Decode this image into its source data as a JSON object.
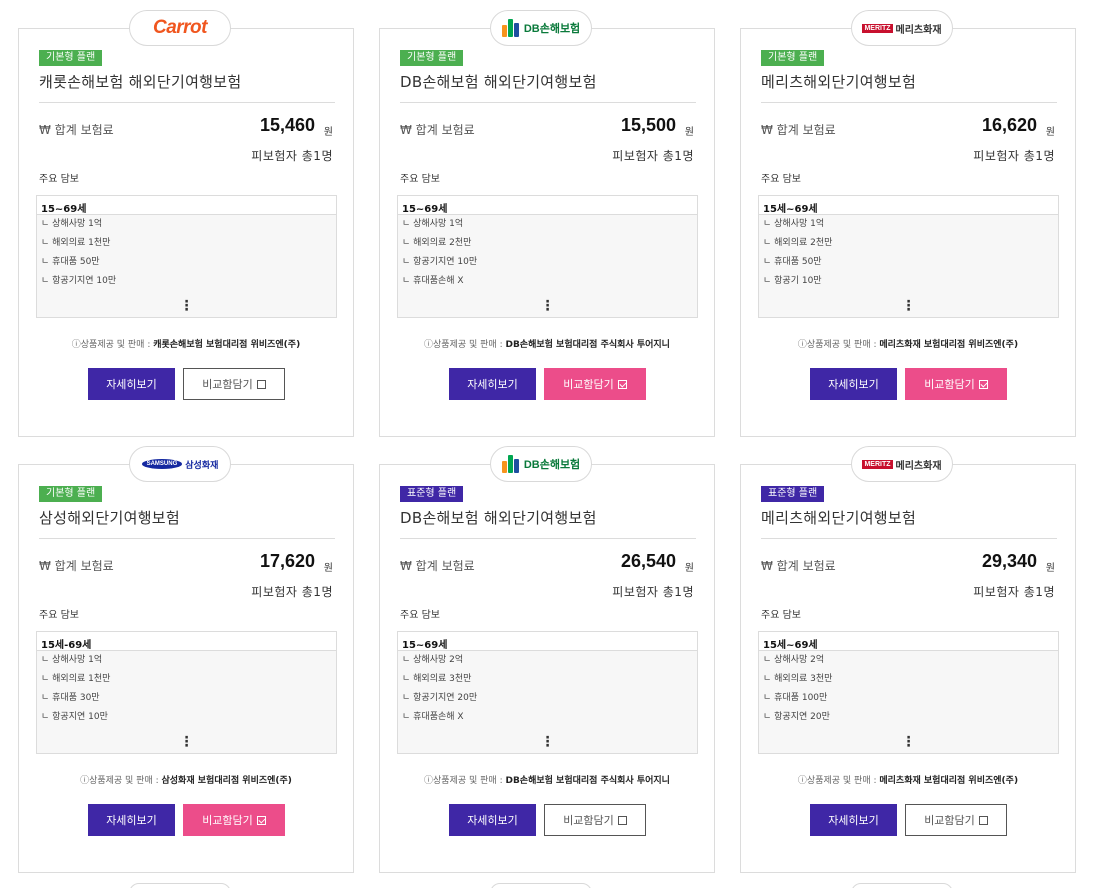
{
  "labels": {
    "premium": "₩ 합계 보험료",
    "unit": "원",
    "insured": "피보험자 총1명",
    "main_coverage": "주요 담보",
    "provider_prefix": "ⓘ상품제공 및 판매 : ",
    "detail_button": "자세히보기",
    "compare_button": "비교함담기",
    "more": "⋮"
  },
  "logos": {
    "carrot": "Carrot",
    "db": "DB손해보험",
    "meritz_mark": "MERITZ",
    "meritz_text": "메리츠화재",
    "samsung_mark": "SAMSUNG",
    "samsung_text": "삼성화재"
  },
  "colors": {
    "detail_button": "#3f27a6",
    "compare_active": "#ec4d8a",
    "badge_basic": "#4caf50",
    "badge_standard": "#3f27a6"
  },
  "cards": [
    {
      "logo": "carrot",
      "plan": "기본형 플랜",
      "plan_type": "basic",
      "title": "캐롯손해보험 해외단기여행보험",
      "amount": "15,460",
      "age": "15~69세",
      "coverages": [
        "ㄴ 상해사망 1억",
        "ㄴ 해외의료 1천만",
        "ㄴ 휴대품 50만",
        "ㄴ 항공기지연 10만"
      ],
      "provider": "캐롯손해보험 보험대리점 위비즈엔(주)",
      "compared": false
    },
    {
      "logo": "db",
      "plan": "기본형 플랜",
      "plan_type": "basic",
      "title": "DB손해보험 해외단기여행보험",
      "amount": "15,500",
      "age": "15~69세",
      "coverages": [
        "ㄴ 상해사망 1억",
        "ㄴ 해외의료 2천만",
        "ㄴ 항공기지연 10만",
        "ㄴ 휴대품손해 X"
      ],
      "provider": "DB손해보험 보험대리점 주식회사 투어지니",
      "compared": true
    },
    {
      "logo": "meritz",
      "plan": "기본형 플랜",
      "plan_type": "basic",
      "title": "메리츠해외단기여행보험",
      "amount": "16,620",
      "age": "15세~69세",
      "coverages": [
        "ㄴ 상해사망 1억",
        "ㄴ 해외의료 2천만",
        "ㄴ 휴대품 50만",
        "ㄴ 항공기 10만"
      ],
      "provider": "메리츠화재 보험대리점 위비즈엔(주)",
      "compared": true
    },
    {
      "logo": "samsung",
      "plan": "기본형 플랜",
      "plan_type": "basic",
      "title": "삼성해외단기여행보험",
      "amount": "17,620",
      "age": "15세-69세",
      "coverages": [
        "ㄴ 상해사망 1억",
        "ㄴ 해외의료 1천만",
        "ㄴ 휴대품 30만",
        "ㄴ 항공지연 10만"
      ],
      "provider": "삼성화재 보험대리점 위비즈엔(주)",
      "compared": true
    },
    {
      "logo": "db",
      "plan": "표준형 플랜",
      "plan_type": "standard",
      "title": "DB손해보험 해외단기여행보험",
      "amount": "26,540",
      "age": "15~69세",
      "coverages": [
        "ㄴ 상해사망 2억",
        "ㄴ 해외의료 3천만",
        "ㄴ 항공기지연 20만",
        "ㄴ 휴대품손해 X"
      ],
      "provider": "DB손해보험 보험대리점 주식회사 투어지니",
      "compared": false
    },
    {
      "logo": "meritz",
      "plan": "표준형 플랜",
      "plan_type": "standard",
      "title": "메리츠해외단기여행보험",
      "amount": "29,340",
      "age": "15세~69세",
      "coverages": [
        "ㄴ 상해사망 2억",
        "ㄴ 해외의료 3천만",
        "ㄴ 휴대품 100만",
        "ㄴ 항공지연 20만"
      ],
      "provider": "메리츠화재 보험대리점 위비즈엔(주)",
      "compared": false
    }
  ]
}
